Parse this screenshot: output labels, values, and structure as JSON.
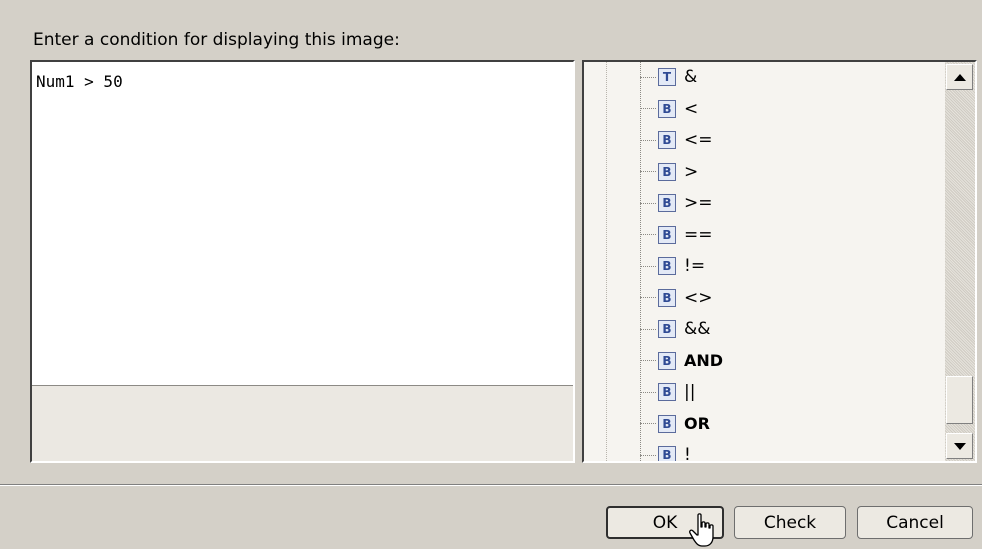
{
  "prompt_label": "Enter a condition for displaying this image:",
  "editor": {
    "value": "Num1 > 50"
  },
  "tree": {
    "items": [
      {
        "icon": "T",
        "label": "&",
        "bold": false
      },
      {
        "icon": "B",
        "label": "<",
        "bold": false
      },
      {
        "icon": "B",
        "label": "<=",
        "bold": false
      },
      {
        "icon": "B",
        "label": ">",
        "bold": false
      },
      {
        "icon": "B",
        "label": ">=",
        "bold": false
      },
      {
        "icon": "B",
        "label": "==",
        "bold": false
      },
      {
        "icon": "B",
        "label": "!=",
        "bold": false
      },
      {
        "icon": "B",
        "label": "<>",
        "bold": false
      },
      {
        "icon": "B",
        "label": "&&",
        "bold": false
      },
      {
        "icon": "B",
        "label": "AND",
        "bold": true
      },
      {
        "icon": "B",
        "label": "||",
        "bold": false
      },
      {
        "icon": "B",
        "label": "OR",
        "bold": true
      },
      {
        "icon": "B",
        "label": "!",
        "bold": false
      }
    ]
  },
  "buttons": {
    "ok": "OK",
    "check": "Check",
    "cancel": "Cancel"
  },
  "icons": {
    "scroll_up": "triangle-up-icon",
    "scroll_down": "triangle-down-icon",
    "cursor": "hand-pointer-icon"
  }
}
